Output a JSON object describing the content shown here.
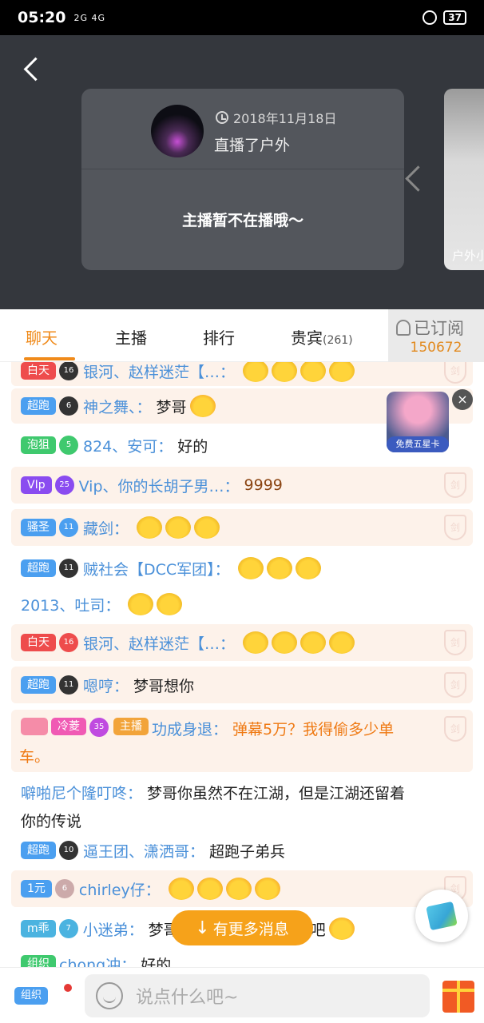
{
  "status_bar": {
    "time": "05:20",
    "signal": "2G 4G",
    "battery": "37"
  },
  "live_card": {
    "date": "2018年11月18日",
    "broadcast": "直播了户外",
    "offline_text": "主播暂不在播哦～",
    "side_card_label": "户外小"
  },
  "tabs": {
    "chat": "聊天",
    "anchor": "主播",
    "rank": "排行",
    "vip": "贵宾",
    "vip_count": "(261)"
  },
  "subscribe": {
    "label": "已订阅",
    "count": "150672"
  },
  "chat": [
    {
      "badge": "白天",
      "level": "16",
      "name": "银河、赵样迷茫【…：",
      "msg": ""
    },
    {
      "badge": "超跑",
      "level": "6",
      "name": "神之舞、：",
      "msg": "梦哥"
    },
    {
      "badge": "泡狙",
      "level": "5",
      "name": "824、安可：",
      "msg": "好的"
    },
    {
      "badge": "VIp",
      "level": "25",
      "name": "Vip、你的长胡子男…：",
      "msg": "9999"
    },
    {
      "badge": "骚圣",
      "level": "11",
      "name": "藏剑：",
      "msg": ""
    },
    {
      "badge": "超跑",
      "level": "11",
      "name": "贼社会【DCC军团】：",
      "msg": ""
    },
    {
      "badge": "",
      "level": "",
      "name": "2013、吐司：",
      "msg": ""
    },
    {
      "badge": "白天",
      "level": "16",
      "name": "银河、赵样迷茫【…：",
      "msg": ""
    },
    {
      "badge": "超跑",
      "level": "11",
      "name": "嗯哼：",
      "msg": "梦哥想你"
    },
    {
      "badge": "冷菱",
      "level": "35",
      "name": "功成身退：",
      "msg": "弹幕5万？我得偷多少单",
      "msg2": "车。",
      "tag": "主播"
    },
    {
      "badge": "",
      "level": "",
      "name": "噼啪尼个隆叮咚：",
      "msg": "梦哥你虽然不在江湖，但是江湖还留着",
      "msg2": "你的传说"
    },
    {
      "badge": "超跑",
      "level": "10",
      "name": "逼王团、潇洒哥：",
      "msg": "超跑子弟兵"
    },
    {
      "badge": "1元",
      "level": "6",
      "name": "chirley仔：",
      "msg": ""
    },
    {
      "badge": "m乖",
      "level": "7",
      "name": "小迷弟：",
      "msg": "梦哥",
      "msg_tail": "饭吧"
    },
    {
      "badge": "组织",
      "level": "",
      "name": "chong冲：",
      "msg": "好的"
    }
  ],
  "promo": {
    "label": "免费五星卡"
  },
  "more_messages": "有更多消息",
  "bottom": {
    "org_label": "组织",
    "input_placeholder": "说点什么吧~"
  },
  "shield_char": "剑"
}
